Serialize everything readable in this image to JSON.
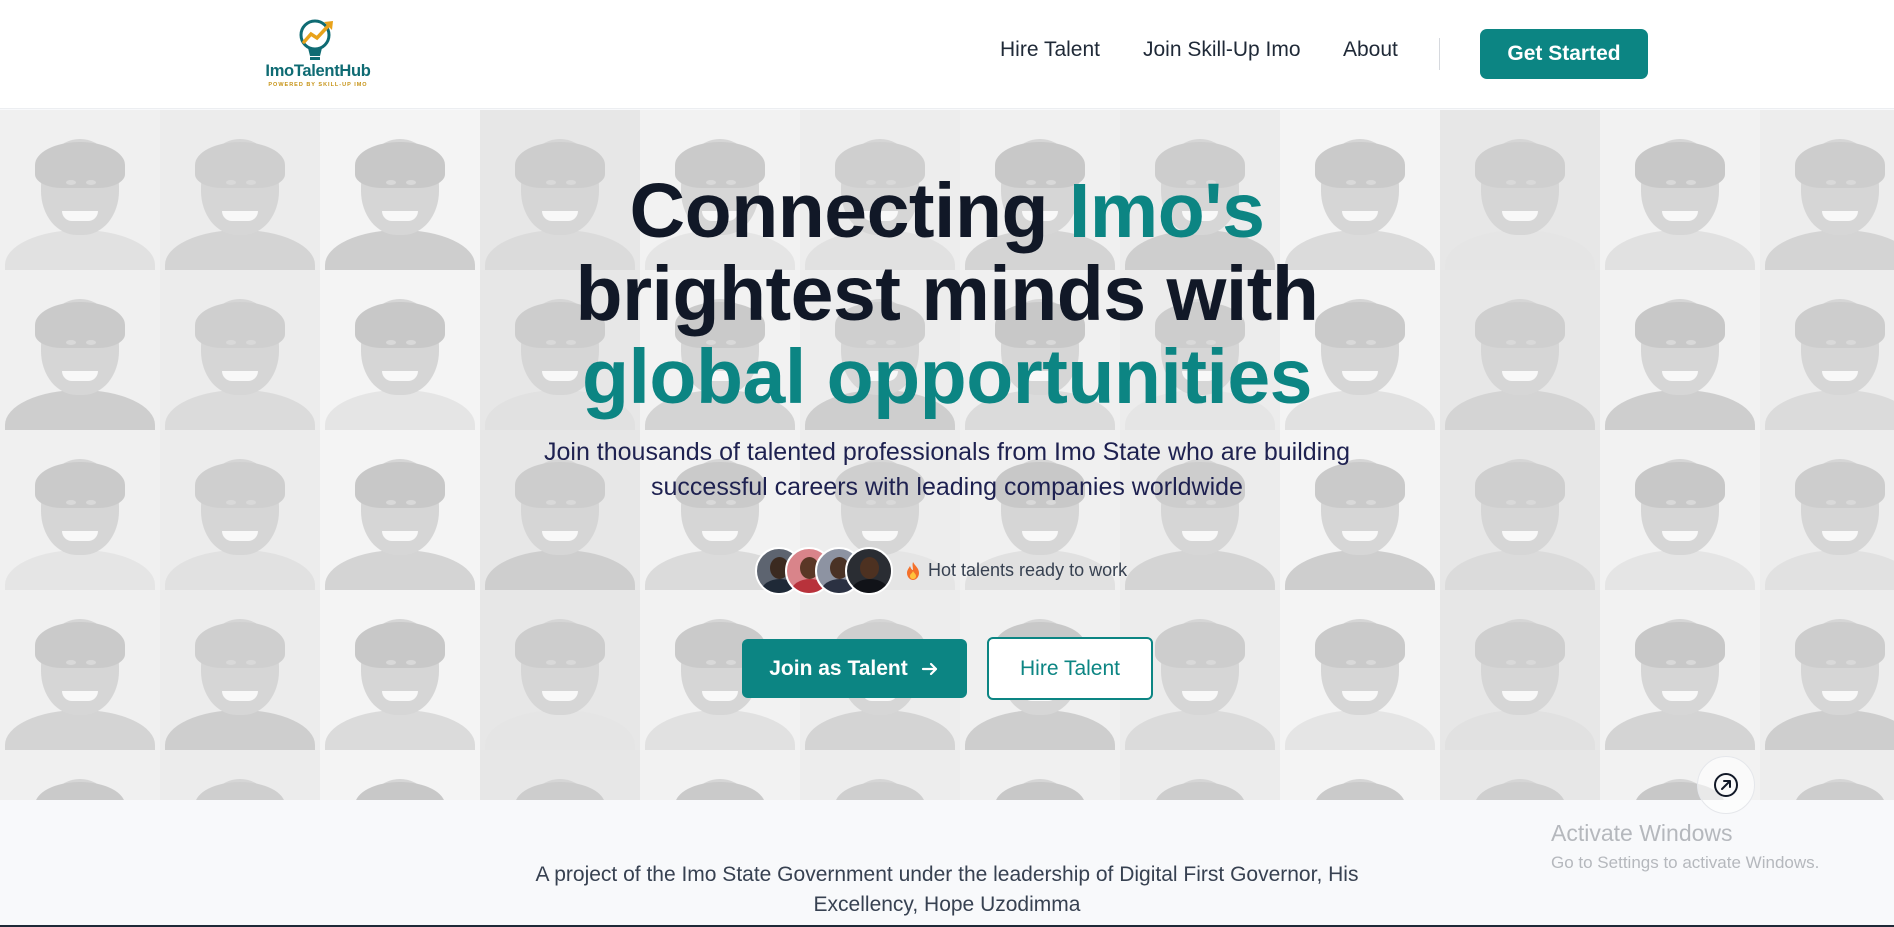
{
  "brand": {
    "name": "ImoTalentHub",
    "tagline": "POWERED BY SKILL-UP IMO",
    "colors": {
      "primary": "#0c8583",
      "gold": "#e8a21a",
      "dark": "#111827"
    }
  },
  "nav": {
    "items": [
      {
        "label": "Hire Talent"
      },
      {
        "label": "Join Skill-Up Imo"
      },
      {
        "label": "About"
      }
    ],
    "cta": "Get Started"
  },
  "hero": {
    "title_part1": "Connecting ",
    "title_accent1": "Imo's",
    "title_part2": "brightest minds with",
    "title_accent2": "global opportunities",
    "subtitle": "Join thousands of talented professionals from Imo State who are building successful careers with leading companies worldwide",
    "hot_talents": "Hot talents ready to work",
    "hot_icon": "flame-icon",
    "primary_button": "Join as Talent",
    "primary_button_icon": "arrow-right-icon",
    "secondary_button": "Hire Talent"
  },
  "footer_note": "A project of the Imo State Government under the leadership of Digital First Governor, His Excellency, Hope Uzodimma",
  "scroll_button_icon": "arrow-up-right-icon",
  "os_watermark": {
    "title": "Activate Windows",
    "subtitle": "Go to Settings to activate Windows."
  }
}
